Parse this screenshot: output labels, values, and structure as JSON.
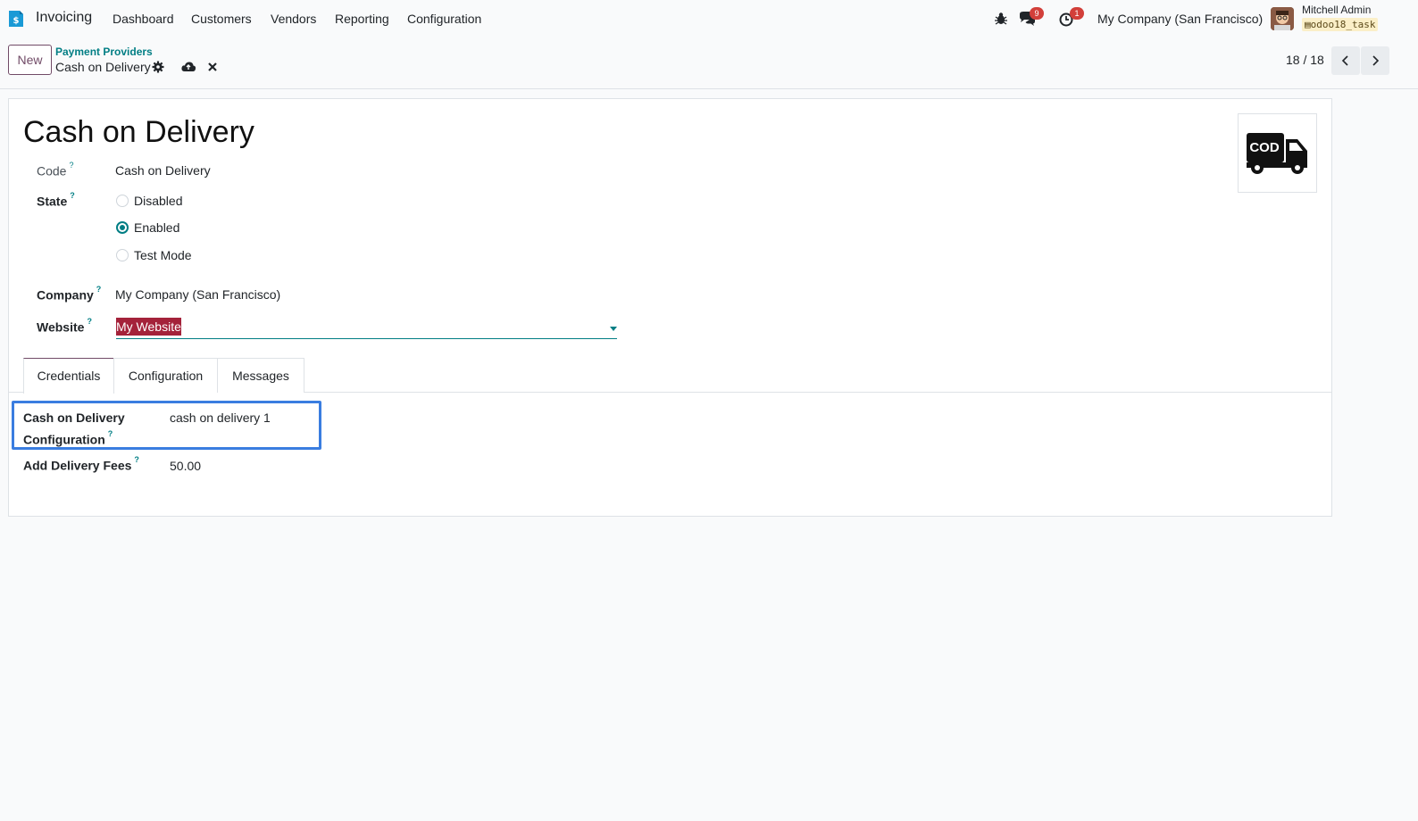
{
  "navbar": {
    "app_name": "Invoicing",
    "menu": [
      "Dashboard",
      "Customers",
      "Vendors",
      "Reporting",
      "Configuration"
    ],
    "messages_count": "9",
    "activities_count": "1",
    "company": "My Company (San Francisco)",
    "user_name": "Mitchell Admin",
    "database": "odoo18_task"
  },
  "control": {
    "new_label": "New",
    "breadcrumb_parent": "Payment Providers",
    "breadcrumb_current": "Cash on Delivery",
    "pager": "18 / 18"
  },
  "form": {
    "title": "Cash on Delivery",
    "code_label": "Code",
    "code_value": "Cash on Delivery",
    "state_label": "State",
    "state_options": [
      "Disabled",
      "Enabled",
      "Test Mode"
    ],
    "state_selected": "Enabled",
    "company_label": "Company",
    "company_value": "My Company (San Francisco)",
    "website_label": "Website",
    "website_value": "My Website",
    "logo_text": "COD"
  },
  "tabs": [
    "Credentials",
    "Configuration",
    "Messages"
  ],
  "active_tab": "Credentials",
  "credentials": {
    "config_label_line1": "Cash on Delivery",
    "config_label_line2": "Configuration",
    "config_value": "cash on delivery 1",
    "fees_label": "Add Delivery Fees",
    "fees_value": "50.00"
  },
  "colors": {
    "brand": "#714b67",
    "accent": "#017e84",
    "badge": "#d23f3a",
    "selection": "#a4223a",
    "focus": "#3a7de0"
  }
}
